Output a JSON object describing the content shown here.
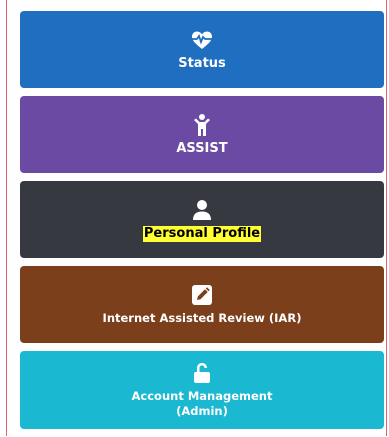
{
  "tiles": [
    {
      "label": "Status",
      "icon": "heartbeat-icon",
      "color": "#1f6ebf"
    },
    {
      "label": "ASSIST",
      "icon": "person-child-icon",
      "color": "#6a4aa3"
    },
    {
      "label": "Personal Profile",
      "icon": "user-icon",
      "color": "#363a40",
      "highlight": "#ffff33"
    },
    {
      "label": "Internet Assisted Review (IAR)",
      "icon": "edit-icon",
      "color": "#7c3f1c"
    },
    {
      "label_line1": "Account Management",
      "label_line2": "(Admin)",
      "icon": "unlock-icon",
      "color": "#1ab9d1"
    }
  ]
}
